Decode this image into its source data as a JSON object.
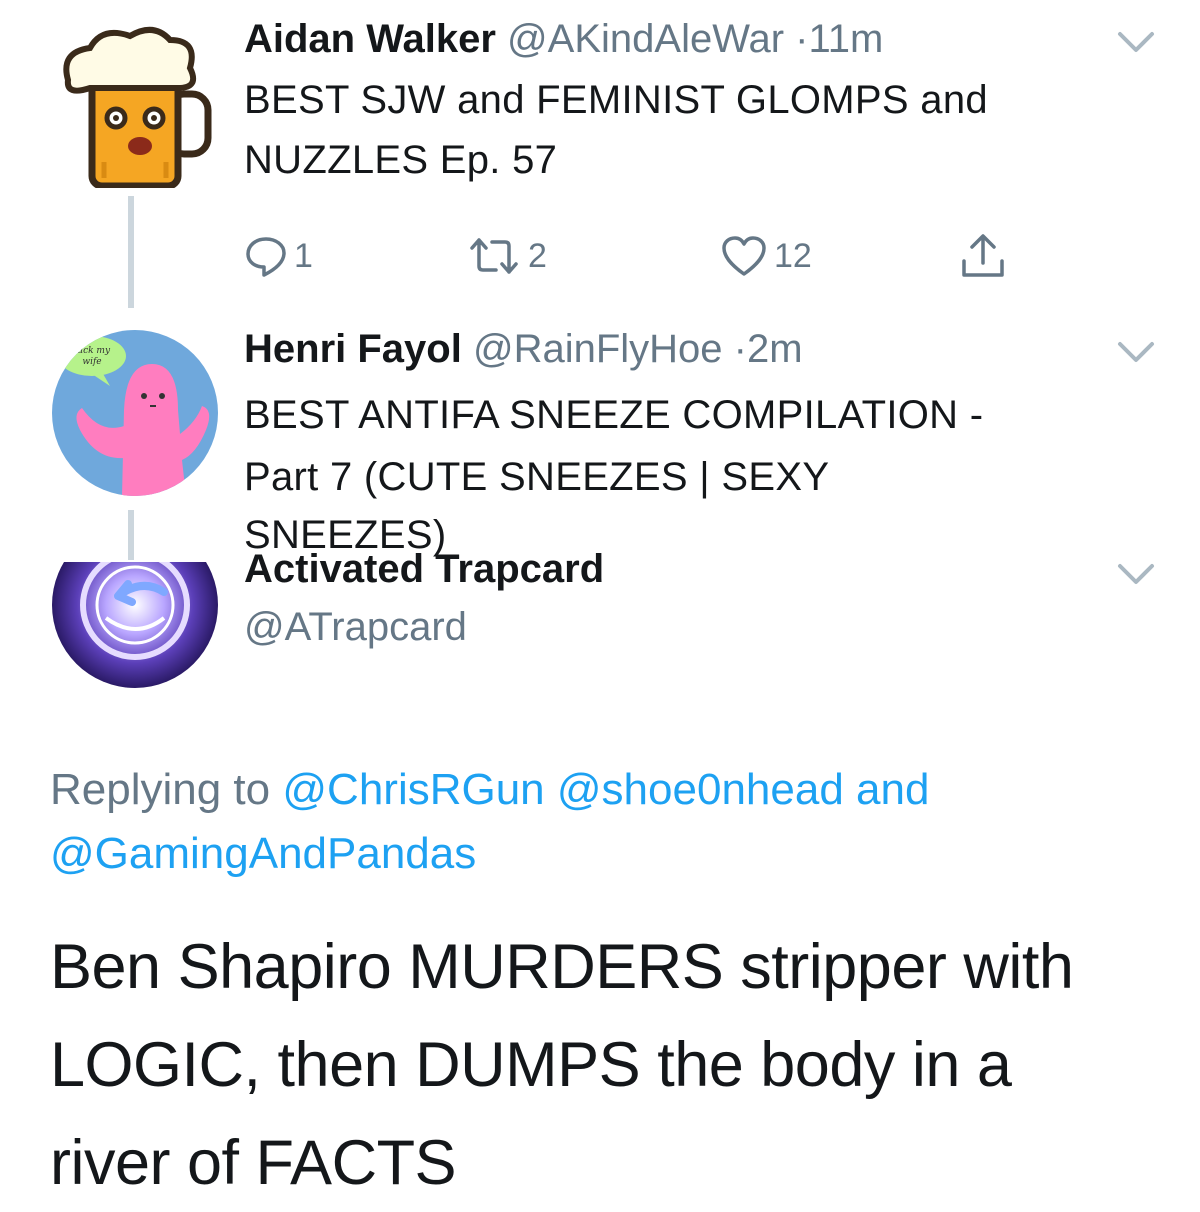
{
  "tweets": [
    {
      "name": "Aidan Walker",
      "handle": "@AKindAleWar",
      "separator": "·",
      "time": "11m",
      "text_lines": [
        "BEST SJW and FEMINIST GLOMPS and",
        "NUZZLES Ep. 57"
      ],
      "actions": {
        "reply_count": "1",
        "retweet_count": "2",
        "like_count": "12"
      },
      "avatar_icon": "beer-mug-icon"
    },
    {
      "name": "Henri Fayol",
      "handle": "@RainFlyHoe",
      "separator": "·",
      "time": "2m",
      "text_lines": [
        "BEST ANTIFA SNEEZE COMPILATION -",
        "Part 7 (CUTE SNEEZES | SEXY",
        "SNEEZES)"
      ],
      "avatar_icon": "pink-blob-icon",
      "avatar_bubble_text": "fuck my wife"
    }
  ],
  "focused_tweet": {
    "name": "Activated Trapcard",
    "handle": "@ATrapcard",
    "avatar_icon": "trapcard-vortex-icon",
    "replying_label": "Replying to",
    "reply_targets": [
      "@ChrisRGun",
      "@shoe0nhead",
      "@GamingAndPandas"
    ],
    "and_word": "and",
    "text_lines": [
      "Ben Shapiro MURDERS stripper with",
      "LOGIC, then DUMPS the body in a",
      "river of FACTS"
    ]
  },
  "colors": {
    "text": "#14171a",
    "meta": "#657786",
    "link": "#1da1f2",
    "thread_line": "#ccd6dd",
    "chevron": "#aab8c2"
  }
}
